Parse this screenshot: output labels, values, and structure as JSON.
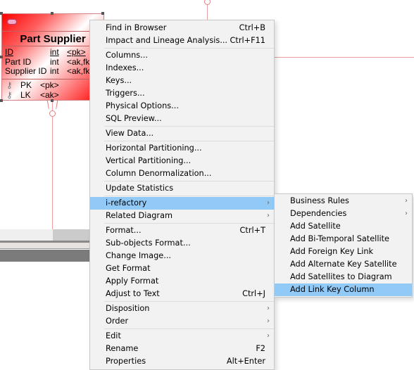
{
  "entity": {
    "title": "Part Supplier",
    "icon": "entity-icon",
    "columns": [
      {
        "name": "ID",
        "type": "int",
        "key": "<pk>"
      },
      {
        "name": "Part ID",
        "type": "int",
        "key": "<ak,fk"
      },
      {
        "name": "Supplier ID",
        "type": "int",
        "key": "<ak,fk"
      }
    ],
    "keys": [
      {
        "name": "PK",
        "type": "<pk>"
      },
      {
        "name": "LK",
        "type": "<ak>"
      }
    ]
  },
  "context_menu": {
    "groups": [
      [
        {
          "label": "Find in Browser",
          "shortcut": "Ctrl+B"
        },
        {
          "label": "Impact and Lineage Analysis...",
          "shortcut": "Ctrl+F11"
        }
      ],
      [
        {
          "label": "Columns..."
        },
        {
          "label": "Indexes..."
        },
        {
          "label": "Keys..."
        },
        {
          "label": "Triggers..."
        },
        {
          "label": "Physical Options..."
        },
        {
          "label": "SQL Preview..."
        }
      ],
      [
        {
          "label": "View Data..."
        }
      ],
      [
        {
          "label": "Horizontal Partitioning..."
        },
        {
          "label": "Vertical Partitioning..."
        },
        {
          "label": "Column Denormalization..."
        }
      ],
      [
        {
          "label": "Update Statistics"
        }
      ],
      [
        {
          "label": "i-refactory",
          "submenu": true,
          "highlighted": true
        },
        {
          "label": "Related Diagram",
          "submenu": true
        }
      ],
      [
        {
          "label": "Format...",
          "shortcut": "Ctrl+T"
        },
        {
          "label": "Sub-objects Format..."
        },
        {
          "label": "Change Image..."
        },
        {
          "label": "Get Format"
        },
        {
          "label": "Apply Format"
        },
        {
          "label": "Adjust to Text",
          "shortcut": "Ctrl+J"
        }
      ],
      [
        {
          "label": "Disposition",
          "submenu": true
        },
        {
          "label": "Order",
          "submenu": true
        }
      ],
      [
        {
          "label": "Edit",
          "submenu": true
        },
        {
          "label": "Rename",
          "shortcut": "F2"
        },
        {
          "label": "Properties",
          "shortcut": "Alt+Enter"
        }
      ]
    ]
  },
  "submenu": {
    "items": [
      {
        "label": "Business Rules",
        "submenu": true
      },
      {
        "label": "Dependencies",
        "submenu": true
      },
      {
        "label": "Add Satellite"
      },
      {
        "label": "Add Bi-Temporal Satellite"
      },
      {
        "label": "Add Foreign Key Link"
      },
      {
        "label": "Add Alternate Key Satellite"
      },
      {
        "label": "Add Satellites to Diagram"
      },
      {
        "label": "Add Link Key Column",
        "highlighted": true
      }
    ]
  },
  "colors": {
    "highlight": "#91c9f7",
    "entity_red": "#ff0000",
    "link_line": "#e8a0a0"
  }
}
